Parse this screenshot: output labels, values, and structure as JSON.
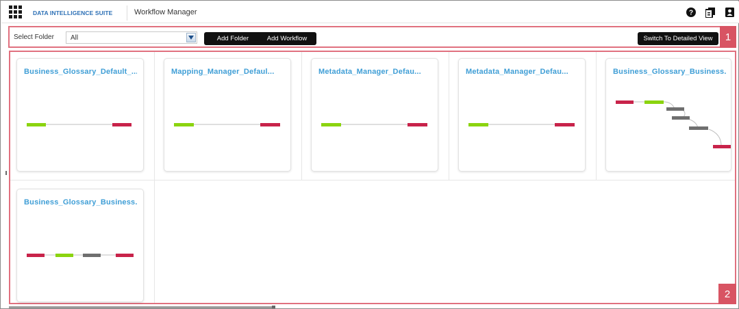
{
  "header": {
    "suite_name": "DATA INTELLIGENCE SUITE",
    "app_title": "Workflow Manager",
    "icons": [
      "apps-grid-icon",
      "help-icon",
      "docs-icon",
      "user-icon"
    ]
  },
  "toolbar": {
    "select_label": "Select Folder",
    "select_value": "All",
    "add_folder_label": "Add Folder",
    "add_workflow_label": "Add Workflow",
    "switch_view_label": "Switch To Detailed View",
    "callout": "1"
  },
  "content": {
    "callout": "2",
    "cards": [
      {
        "title": "Business_Glossary_Default_..."
      },
      {
        "title": "Mapping_Manager_Defaul..."
      },
      {
        "title": "Metadata_Manager_Defau..."
      },
      {
        "title": "Metadata_Manager_Defau..."
      },
      {
        "title": "Business_Glossary_Business..."
      },
      {
        "title": "Business_Glossary_Business..."
      }
    ]
  },
  "colors": {
    "accent_title": "#3f9ed6",
    "start_node": "#8bd40f",
    "end_node": "#c8234a",
    "mid_node": "#6f6f6f",
    "callout": "#d85463"
  }
}
